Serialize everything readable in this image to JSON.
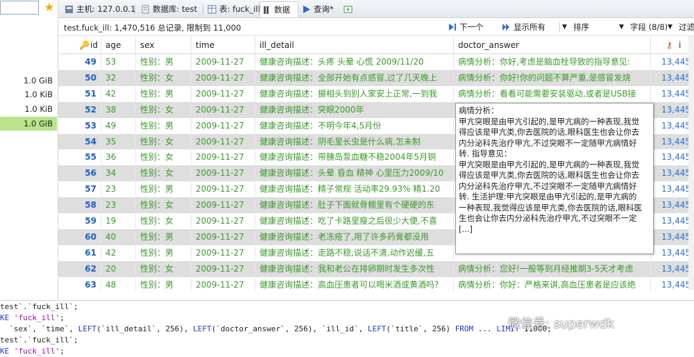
{
  "sidebar": {
    "sizes": [
      {
        "value": "1.0 GiB",
        "selected": false
      },
      {
        "value": "1.0 KiB",
        "selected": false
      },
      {
        "value": "1.0 KiB",
        "selected": false
      },
      {
        "value": "1.0 GiB",
        "selected": true
      }
    ]
  },
  "tabs": [
    {
      "label": "主机: 127.0.0.1",
      "icon": "host-icon"
    },
    {
      "label": "数据库: test",
      "icon": "database-icon"
    },
    {
      "label": "表: fuck_ill",
      "icon": "table-icon"
    },
    {
      "label": "数据",
      "icon": "data-icon",
      "active": true
    },
    {
      "label": "查询*",
      "icon": "query-icon"
    }
  ],
  "info": {
    "summary": "test.fuck_ill: 1,470,516 总记录, 限制到 11,000",
    "next": "下一个",
    "show_all": "显示所有",
    "sort": "排序",
    "fields": "字段 (8/8)",
    "filter": "过滤"
  },
  "columns": [
    "id",
    "age",
    "sex",
    "time",
    "ill_detail",
    "doctor_answer",
    "i"
  ],
  "rows": [
    {
      "id": "49",
      "age": "53",
      "sex": "性别：男",
      "time": "2009-11-27",
      "ill_detail": "健康咨询描述：头疼  头晕  心慌  2009/11/20",
      "doctor_answer": "病情分析：你好,考虑是脑血栓导致的指导意见:",
      "last": "13,445"
    },
    {
      "id": "50",
      "age": "32",
      "sex": "性别：女",
      "time": "2009-11-27",
      "ill_detail": "健康咨询描述：全部开始有点感冒,过了几天晚上",
      "doctor_answer": "病情分析：你好!你的问题不算严重,是感冒发烧",
      "last": "13,445"
    },
    {
      "id": "51",
      "age": "42",
      "sex": "性别：男",
      "time": "2009-11-27",
      "ill_detail": "健康咨询描述：摄相头到别人家安上正常,一到我",
      "doctor_answer": "病情分析：看看可能需要安装驱动,或者是USB接",
      "last": "13,445"
    },
    {
      "id": "52",
      "age": "38",
      "sex": "性别：女",
      "time": "2009-11-27",
      "ill_detail": "健康咨询描述：突眼2000年",
      "doctor_answer": "",
      "last": "13,445"
    },
    {
      "id": "53",
      "age": "49",
      "sex": "性别：男",
      "time": "2009-11-27",
      "ill_detail": "健康咨询描述：不明今年4,5月份",
      "doctor_answer": "",
      "last": "13,445"
    },
    {
      "id": "54",
      "age": "35",
      "sex": "性别：女",
      "time": "2009-11-27",
      "ill_detail": "健康咨询描述：阴毛里长虫是什么病,怎未制",
      "doctor_answer": "",
      "last": "13,445"
    },
    {
      "id": "55",
      "age": "36",
      "sex": "性别：女",
      "time": "2009-11-27",
      "ill_detail": "健康咨询描述：带胰岛泵血糖不稳2004年5月铜",
      "doctor_answer": "",
      "last": "13,445"
    },
    {
      "id": "56",
      "age": "34",
      "sex": "性别：女",
      "time": "2009-11-27",
      "ill_detail": "健康咨询描述：头晕 昏血 精神 心里压力2009/10",
      "doctor_answer": "",
      "last": "13,445"
    },
    {
      "id": "57",
      "age": "23",
      "sex": "性别：男",
      "time": "2009-11-27",
      "ill_detail": "健康咨询描述：精子常规 活动率29.93% 精1.20",
      "doctor_answer": "",
      "last": "13,445"
    },
    {
      "id": "58",
      "age": "23",
      "sex": "性别：女",
      "time": "2009-11-27",
      "ill_detail": "健康咨询描述：肚子下面就骨棚里有个硬硬的东",
      "doctor_answer": "",
      "last": "13,445"
    },
    {
      "id": "59",
      "age": "19",
      "age_note": "",
      "sex": "性别：女",
      "time": "2009-11-27",
      "ill_detail": "健康咨询描述：吃了卡路里瘦之后很少大便,不喜",
      "doctor_answer": "",
      "last": "13,445"
    },
    {
      "id": "60",
      "age": "40",
      "sex": "性别：男",
      "time": "2009-11-27",
      "ill_detail": "健康咨询描述：老冻疮了,用了许多药膏都没用",
      "doctor_answer": "",
      "last": "13,445"
    },
    {
      "id": "61",
      "age": "42",
      "sex": "性别：男",
      "time": "2009-11-27",
      "ill_detail": "健康咨询描述：走路不稳,说话不清,动作迟缓,五",
      "doctor_answer": "",
      "last": "13,445"
    },
    {
      "id": "62",
      "age": "20",
      "sex": "性别：女",
      "time": "2009-11-27",
      "ill_detail": "健康咨询描述：我和老公在排卵期时发生多次性",
      "doctor_answer": "病情分析：您好!一般等到月经推期3-5天才考虑",
      "last": "13,445"
    },
    {
      "id": "63",
      "age": "48",
      "sex": "性别：男",
      "time": "2009-11-27",
      "ill_detail": "健康咨询描述：高血压患者可以喝米酒或黄酒吗?",
      "doctor_answer": "病情分析：你好：严格来讲,高血压患者是应该绝",
      "last": "13,445"
    }
  ],
  "tooltip": {
    "lines": [
      "病情分析：",
      "甲亢突眼是由甲亢引起的,是甲亢病的一种表现,我觉",
      "得应该是甲亢类,你去医院的话,眼科医生也会让你去",
      "内分泌科先治疗甲亢,不过突眼不一定随甲亢病情好",
      "转. 指导意见：",
      "甲亢突眼是由甲亢引起的,是甲亢病的一种表现,我觉",
      "得应该是甲亢类,你去医院的话,眼科医生也会让你去",
      "内分泌科先治疗甲亢,不过突眼不一定随甲亢病情好",
      "转. 生活护理:甲亢突眼是由甲亢引起的,是甲亢病的",
      "一种表现,我觉得应该是甲亢类,你去医院的话,眼科医",
      "生也会让你去内分泌科先治疗甲亢,不过突眼不一定",
      "[...]"
    ]
  },
  "sql": {
    "lines": [
      {
        "parts": [
          {
            "t": "test`.`fuck_ill`;",
            "c": ""
          }
        ]
      },
      {
        "parts": [
          {
            "t": "KE ",
            "c": "kw"
          },
          {
            "t": "'fuck_ill'",
            "c": "str"
          },
          {
            "t": ";",
            "c": ""
          }
        ]
      },
      {
        "parts": [
          {
            "t": "  `sex`, `time`, ",
            "c": ""
          },
          {
            "t": "LEFT",
            "c": "kw"
          },
          {
            "t": "(`ill_detail`, 256), ",
            "c": ""
          },
          {
            "t": "LEFT",
            "c": "kw"
          },
          {
            "t": "(`doctor_answer`, 256), `ill_id`, ",
            "c": ""
          },
          {
            "t": "LEFT",
            "c": "kw"
          },
          {
            "t": "(`title`, 256) ",
            "c": ""
          },
          {
            "t": "FROM",
            "c": "kw"
          },
          {
            "t": " ... ",
            "c": ""
          },
          {
            "t": "LIMIT",
            "c": "kw"
          },
          {
            "t": " 11000;",
            "c": ""
          }
        ]
      },
      {
        "parts": [
          {
            "t": "test`.`fuck_ill`;",
            "c": ""
          }
        ]
      },
      {
        "parts": [
          {
            "t": "KE ",
            "c": "kw"
          },
          {
            "t": "'fuck_ill'",
            "c": "str"
          },
          {
            "t": ";",
            "c": ""
          }
        ]
      }
    ]
  },
  "watermark": "微信号: superwdk"
}
